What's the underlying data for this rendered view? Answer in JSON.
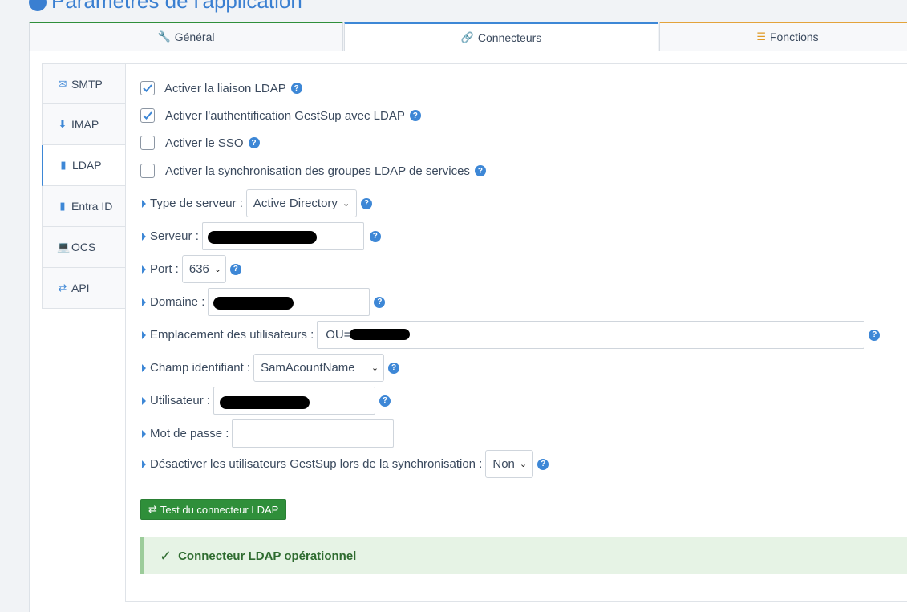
{
  "page": {
    "title": "Paramètres de l'application"
  },
  "tabs": [
    {
      "label": "Général",
      "icon": "wrench-icon"
    },
    {
      "label": "Connecteurs",
      "icon": "link-icon"
    },
    {
      "label": "Fonctions",
      "icon": "list-check-icon"
    }
  ],
  "sidenav": [
    {
      "label": "SMTP",
      "icon": "envelope-icon"
    },
    {
      "label": "IMAP",
      "icon": "download-icon"
    },
    {
      "label": "LDAP",
      "icon": "book-icon",
      "active": true
    },
    {
      "label": "Entra ID",
      "icon": "book-icon"
    },
    {
      "label": "OCS",
      "icon": "monitor-icon"
    },
    {
      "label": "API",
      "icon": "arrows-exchange-icon"
    }
  ],
  "checkboxes": [
    {
      "label": "Activer la liaison LDAP",
      "checked": true
    },
    {
      "label": "Activer l'authentification GestSup avec LDAP",
      "checked": true
    },
    {
      "label": "Activer le SSO",
      "checked": false
    },
    {
      "label": "Activer la synchronisation des groupes LDAP de services",
      "checked": false
    }
  ],
  "fields": {
    "server_type": {
      "label": "Type de serveur :",
      "value": "Active Directory"
    },
    "server": {
      "label": "Serveur :",
      "value": ""
    },
    "port": {
      "label": "Port :",
      "value": "636"
    },
    "domain": {
      "label": "Domaine :",
      "value": ""
    },
    "users_location": {
      "label": "Emplacement des utilisateurs :",
      "value": "OU="
    },
    "id_field": {
      "label": "Champ identifiant :",
      "value": "SamAcountName"
    },
    "user": {
      "label": "Utilisateur :",
      "value": ""
    },
    "password": {
      "label": "Mot de passe :",
      "value": ""
    },
    "disable_users": {
      "label": "Désactiver les utilisateurs GestSup lors de la synchronisation :",
      "value": "Non"
    }
  },
  "test_button": {
    "label": "Test du connecteur LDAP"
  },
  "alert": {
    "text": "Connecteur LDAP opérationnel"
  },
  "colors": {
    "accent": "#3d87d6",
    "success": "#2f8f3a",
    "alert_bg": "#e6f3e5"
  }
}
